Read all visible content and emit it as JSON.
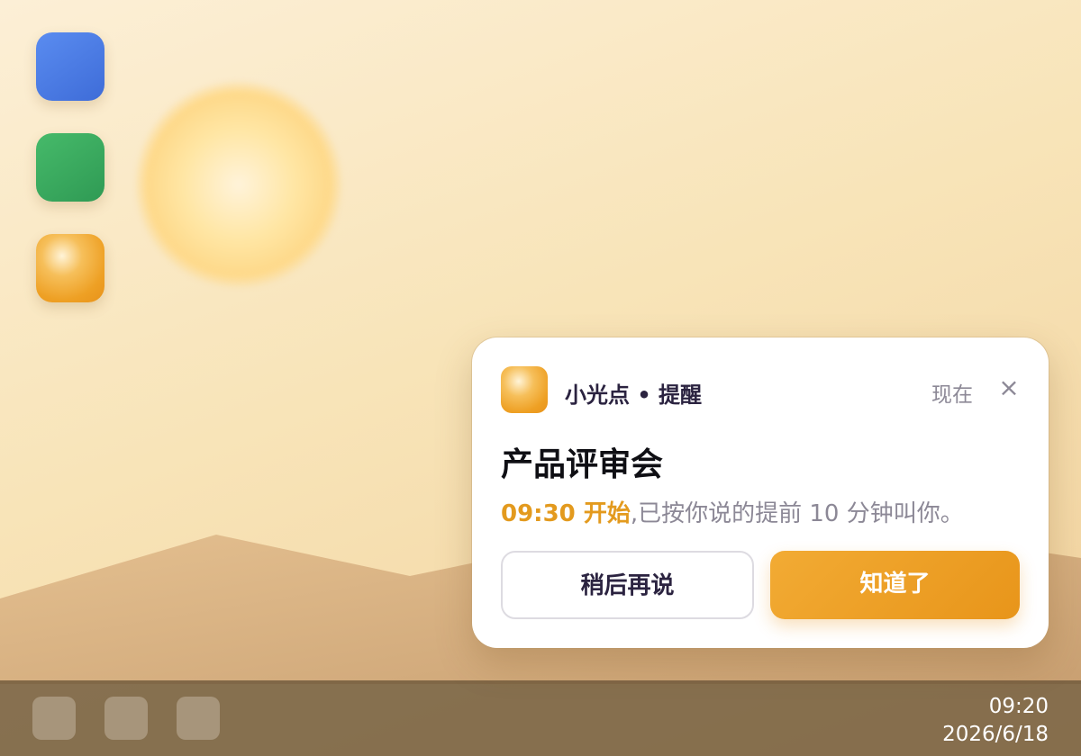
{
  "desktop": {
    "icons": [
      {
        "name": "blue-app-icon",
        "color": "#4a7de6"
      },
      {
        "name": "green-app-icon",
        "color": "#38a85d"
      },
      {
        "name": "xiaoguangdian-app-icon",
        "color": "#eea024"
      }
    ]
  },
  "notification": {
    "app_icon": "xiaoguangdian-app-icon",
    "app_name": "小光点 • 提醒",
    "timestamp": "现在",
    "close_icon": "close-icon",
    "close_glyph": "×",
    "title": "产品评审会",
    "body_highlight": "09:30 开始",
    "body_text": ",已按你说的提前 10 分钟叫你。",
    "snooze_label": "稍后再说",
    "dismiss_label": "知道了",
    "accent_color": "#e8951a"
  },
  "taskbar": {
    "buttons": [
      "taskbar-button-1",
      "taskbar-button-2",
      "taskbar-button-3"
    ],
    "time": "09:20",
    "date": "2026/6/18"
  }
}
